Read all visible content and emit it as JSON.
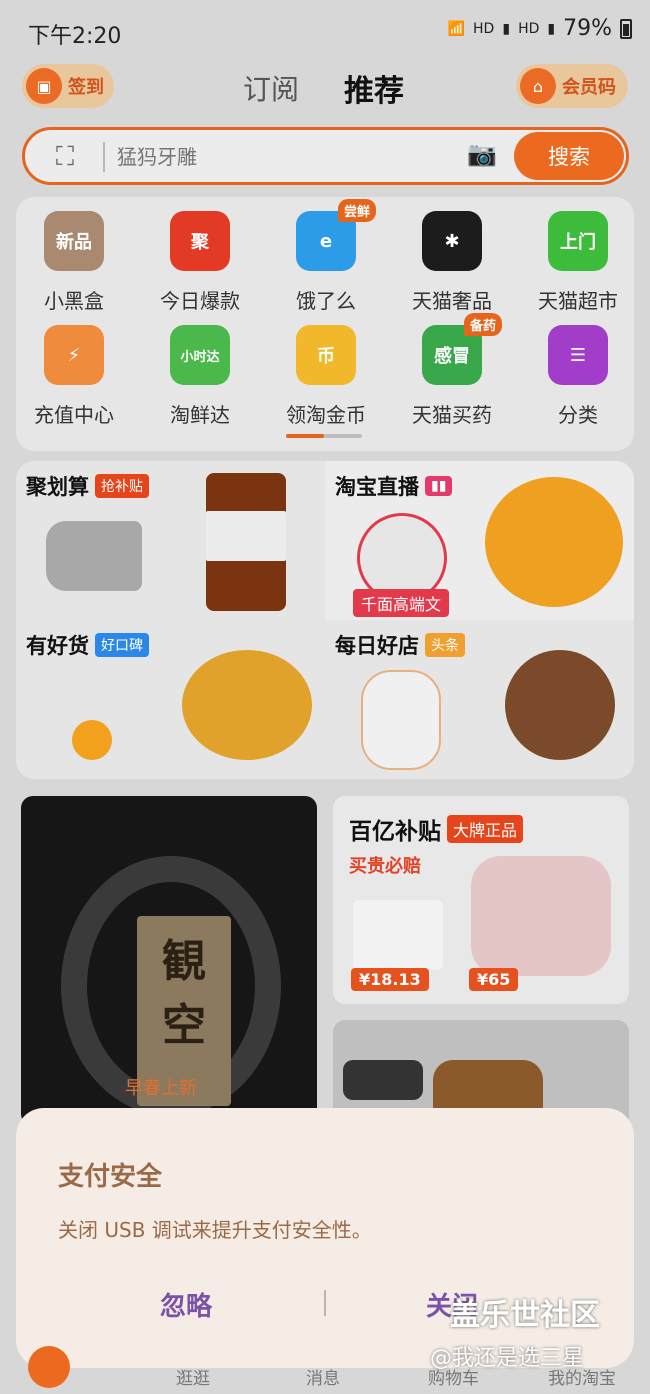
{
  "status": {
    "time": "下午2:20",
    "battery": "79%",
    "net1": "HD",
    "net2": "HD"
  },
  "header": {
    "signin": "签到",
    "tab_subscribe": "订阅",
    "tab_recommend": "推荐",
    "member_code": "会员码"
  },
  "search": {
    "placeholder": "猛犸牙雕",
    "button": "搜索"
  },
  "grid": [
    {
      "label": "小黑盒",
      "icon_text": "新品",
      "color": "#a98a70"
    },
    {
      "label": "今日爆款",
      "icon_text": "聚",
      "color": "#e33a26"
    },
    {
      "label": "饿了么",
      "icon_text": "e",
      "color": "#2c9ce8",
      "badge": "尝鲜"
    },
    {
      "label": "天猫奢品",
      "icon_text": "✱",
      "color": "#1c1c1c"
    },
    {
      "label": "天猫超市",
      "icon_text": "上门",
      "color": "#3dbb3a"
    },
    {
      "label": "充值中心",
      "icon_text": "⚡",
      "color": "#f08a3c"
    },
    {
      "label": "淘鲜达",
      "icon_text": "小时达",
      "color": "#4ab84a"
    },
    {
      "label": "领淘金币",
      "icon_text": "币",
      "color": "#f2b82b"
    },
    {
      "label": "天猫买药",
      "icon_text": "感冒",
      "color": "#38a84a",
      "badge": "备药"
    },
    {
      "label": "分类",
      "icon_text": "☰",
      "color": "#a13dc8"
    }
  ],
  "features": {
    "juhuasuan": {
      "title": "聚划算",
      "tag": "抢补贴"
    },
    "live": {
      "title": "淘宝直播",
      "host_label": "千面高端文"
    },
    "youhaohuo": {
      "title": "有好货",
      "tag": "好口碑"
    },
    "daily": {
      "title": "每日好店",
      "tag": "头条"
    }
  },
  "feed": {
    "dark_card_label": "早春上新",
    "plaque_text": "観\n空",
    "subsidy_title": "百亿补贴",
    "subsidy_tag": "大牌正品",
    "subsidy_sub": "买贵必赔",
    "price1": "¥18.13",
    "price2": "¥65"
  },
  "dialog": {
    "title": "支付安全",
    "message": "关闭 USB 调试来提升支付安全性。",
    "ignore": "忽略",
    "close": "关闭"
  },
  "nav": {
    "browse": "逛逛",
    "messages": "消息",
    "cart": "购物车",
    "mine": "我的淘宝"
  },
  "watermark": {
    "line1": "盖乐世社区",
    "line2": "@我还是选三星"
  }
}
